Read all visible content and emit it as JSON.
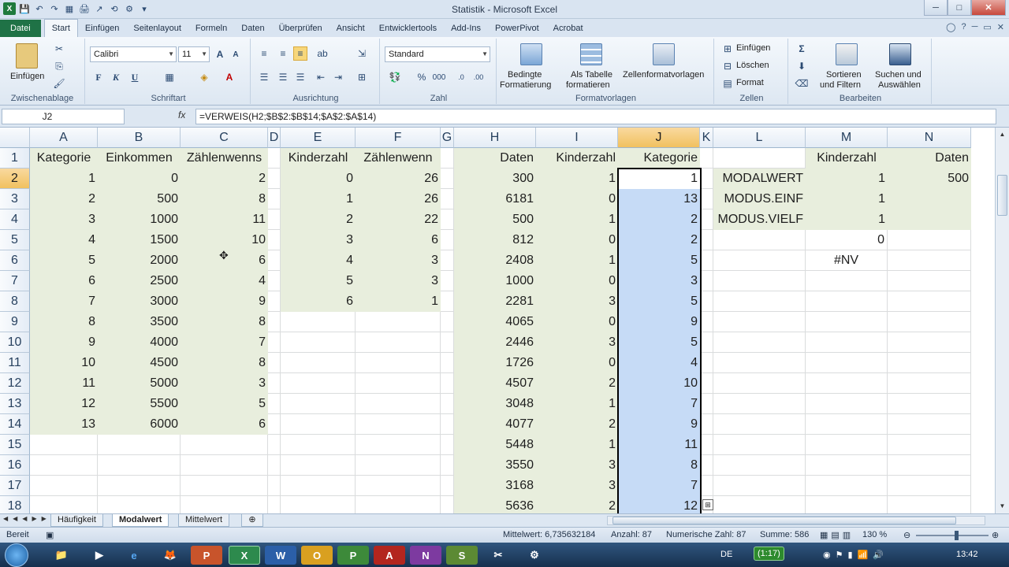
{
  "window": {
    "title": "Statistik - Microsoft Excel",
    "buttons": [
      "─",
      "□",
      "✕"
    ]
  },
  "qat": [
    "X",
    "💾",
    "↶",
    "↷",
    "▦",
    "🖨",
    "↗",
    "⟲",
    "⚙",
    "▾"
  ],
  "tabs": [
    "Datei",
    "Start",
    "Einfügen",
    "Seitenlayout",
    "Formeln",
    "Daten",
    "Überprüfen",
    "Ansicht",
    "Entwicklertools",
    "Add-Ins",
    "PowerPivot",
    "Acrobat"
  ],
  "tab_icons": [
    "◯",
    "?",
    "─",
    "▭",
    "✕"
  ],
  "ribbon": {
    "clipboard": {
      "paste": "Einfügen",
      "label": "Zwischenablage"
    },
    "font": {
      "name": "Calibri",
      "size": "11",
      "label": "Schriftart",
      "bold": "F",
      "italic": "K",
      "underline": "U"
    },
    "alignment": {
      "label": "Ausrichtung"
    },
    "number": {
      "format": "Standard",
      "label": "Zahl",
      "percent": "%",
      "thousands": "000"
    },
    "styles": {
      "cond": "Bedingte",
      "cond2": "Formatierung",
      "table": "Als Tabelle",
      "table2": "formatieren",
      "cellstyles": "Zellenformatvorlagen",
      "label": "Formatvorlagen"
    },
    "cells": {
      "insert": "Einfügen",
      "delete": "Löschen",
      "format": "Format",
      "label": "Zellen"
    },
    "editing": {
      "sort": "Sortieren",
      "sort2": "und Filtern",
      "find": "Suchen und",
      "find2": "Auswählen",
      "label": "Bearbeiten"
    }
  },
  "formula_bar": {
    "name_box": "J2",
    "fx": "fx",
    "formula": "=VERWEIS(H2;$B$2:$B$14;$A$2:$A$14)"
  },
  "columns": [
    "A",
    "B",
    "C",
    "D",
    "E",
    "F",
    "G",
    "H",
    "I",
    "J",
    "K",
    "L",
    "M",
    "N"
  ],
  "rows": [
    "1",
    "2",
    "3",
    "4",
    "5",
    "6",
    "7",
    "8",
    "9",
    "10",
    "11",
    "12",
    "13",
    "14",
    "15",
    "16",
    "17",
    "18"
  ],
  "headers": {
    "A": "Kategorie",
    "B": "Einkommen",
    "C": "Zählenwenns",
    "E": "Kinderzahl",
    "F": "Zählenwenn",
    "H": "Daten",
    "I": "Kinderzahl",
    "J": "Kategorie",
    "M": "Kinderzahl",
    "N": "Daten"
  },
  "colA": [
    "1",
    "2",
    "3",
    "4",
    "5",
    "6",
    "7",
    "8",
    "9",
    "10",
    "11",
    "12",
    "13"
  ],
  "colB": [
    "0",
    "500",
    "1000",
    "1500",
    "2000",
    "2500",
    "3000",
    "3500",
    "4000",
    "4500",
    "5000",
    "5500",
    "6000"
  ],
  "colC": [
    "2",
    "8",
    "11",
    "10",
    "6",
    "4",
    "9",
    "8",
    "7",
    "8",
    "3",
    "5",
    "6"
  ],
  "colE": [
    "0",
    "1",
    "2",
    "3",
    "4",
    "5",
    "6"
  ],
  "colF": [
    "26",
    "26",
    "22",
    "6",
    "3",
    "3",
    "1"
  ],
  "colH": [
    "300",
    "6181",
    "500",
    "812",
    "2408",
    "1000",
    "2281",
    "4065",
    "2446",
    "1726",
    "4507",
    "3048",
    "4077",
    "5448",
    "3550",
    "3168",
    "5636"
  ],
  "colI": [
    "1",
    "0",
    "1",
    "0",
    "1",
    "0",
    "3",
    "0",
    "3",
    "0",
    "2",
    "1",
    "2",
    "1",
    "3",
    "3",
    "2"
  ],
  "colJ": [
    "1",
    "13",
    "2",
    "2",
    "5",
    "3",
    "5",
    "9",
    "5",
    "4",
    "10",
    "7",
    "9",
    "11",
    "8",
    "7",
    "12"
  ],
  "colL": [
    "MODALWERT",
    "MODUS.EINF",
    "MODUS.VIELF"
  ],
  "colM": [
    "1",
    "1",
    "1",
    "0",
    "#NV"
  ],
  "colN": [
    "500"
  ],
  "sheets": [
    "Häufigkeit",
    "Modalwert",
    "Mittelwert"
  ],
  "status": {
    "ready": "Bereit",
    "average": "Mittelwert: 6,735632184",
    "count": "Anzahl: 87",
    "numcount": "Numerische Zahl: 87",
    "sum": "Summe: 586",
    "zoom": "130 %"
  },
  "taskbar": {
    "apps": [
      "📁",
      "▶",
      "🦊",
      "P",
      "X",
      "W",
      "O",
      "P",
      "A",
      "N",
      "S",
      "✂",
      "⚙"
    ],
    "lang": "DE",
    "timer": "(1:17)",
    "clock": "13:42"
  },
  "colors": {
    "green_fill": "#e8eedd",
    "blue_sel": "#c6dbf6",
    "selected_header": "#f1c15f",
    "file_tab": "#1f7246"
  }
}
